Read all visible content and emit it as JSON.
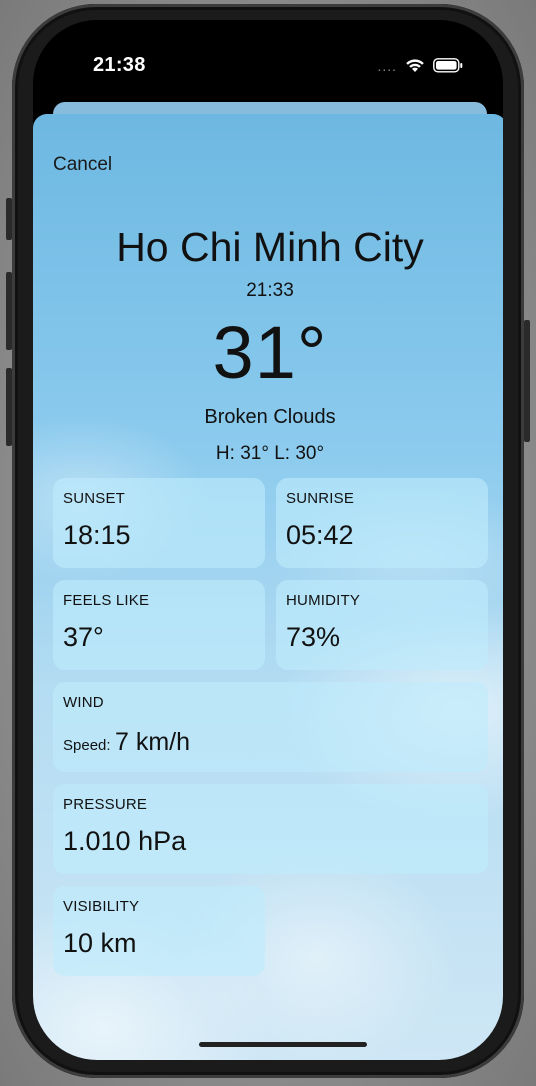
{
  "status_bar": {
    "time": "21:38",
    "signal_dots": "....",
    "wifi_icon": "wifi-icon",
    "battery_icon": "battery-icon"
  },
  "sheet": {
    "cancel_label": "Cancel"
  },
  "weather": {
    "city": "Ho Chi Minh City",
    "local_time": "21:33",
    "temperature": "31°",
    "description": "Broken Clouds",
    "high_low": "H: 31°  L: 30°"
  },
  "cards": {
    "sunset": {
      "label": "SUNSET",
      "value": "18:15"
    },
    "sunrise": {
      "label": "SUNRISE",
      "value": "05:42"
    },
    "feels_like": {
      "label": "FEELS LIKE",
      "value": "37°"
    },
    "humidity": {
      "label": "HUMIDITY",
      "value": "73%"
    },
    "wind": {
      "label": "WIND",
      "speed_prefix": "Speed:",
      "speed_value": "7 km/h"
    },
    "pressure": {
      "label": "PRESSURE",
      "value": "1.010 hPa"
    },
    "visibility": {
      "label": "VISIBILITY",
      "value": "10 km"
    }
  },
  "colors": {
    "sky_top": "#6db8e2",
    "sky_bottom": "#cfe7f5",
    "card_tint": "#beebfc"
  }
}
